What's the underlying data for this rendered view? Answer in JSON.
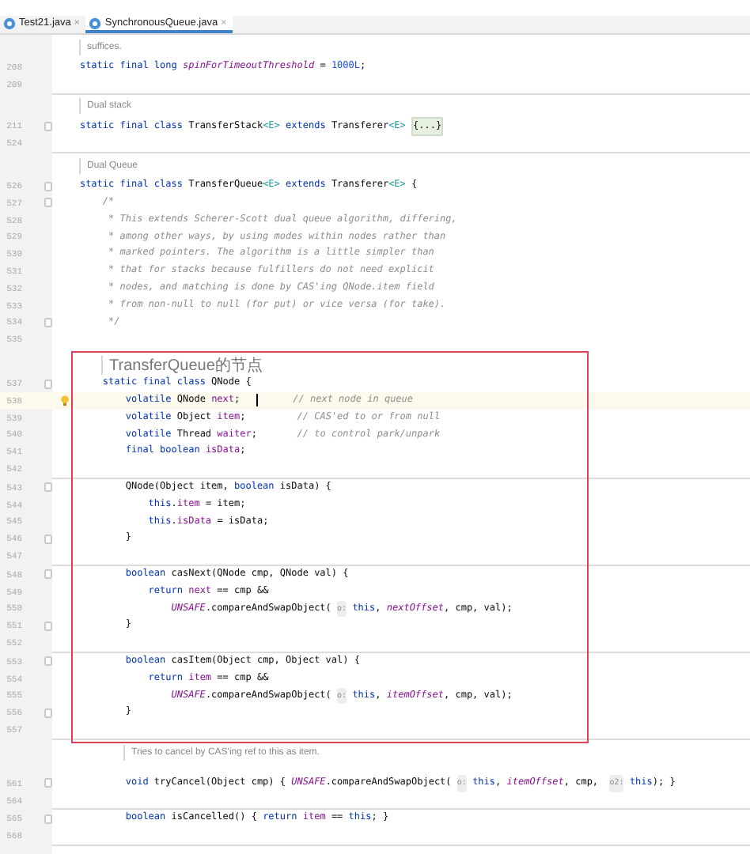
{
  "tabs": [
    {
      "label": "Test21.java",
      "close": "×",
      "selected": false
    },
    {
      "label": "SynchronousQueue.java",
      "close": "×",
      "selected": true
    }
  ],
  "rows": [
    {
      "kind": "doc_class",
      "text": "suffices."
    },
    {
      "kind": "code",
      "number": "208",
      "fold": false,
      "current": false,
      "tokens": [
        {
          "kind": "keyword",
          "t": "    static final long "
        },
        {
          "kind": "static",
          "t": "spinForTimeoutThreshold"
        },
        {
          "kind": "plain",
          "t": " = "
        },
        {
          "kind": "number",
          "t": "1000L"
        },
        {
          "kind": "plain",
          "t": ";"
        }
      ]
    },
    {
      "kind": "code",
      "number": "209",
      "fold": false,
      "current": false,
      "tokens": []
    },
    {
      "kind": "separator"
    },
    {
      "kind": "doc_class",
      "text": "Dual stack"
    },
    {
      "kind": "code",
      "number": "211",
      "fold": true,
      "current": false,
      "tokens": [
        {
          "kind": "keyword",
          "t": "    static final class "
        },
        {
          "kind": "plain",
          "t": "TransferStack"
        },
        {
          "kind": "generic",
          "t": "<E>"
        },
        {
          "kind": "keyword",
          "t": " extends "
        },
        {
          "kind": "plain",
          "t": "Transferer"
        },
        {
          "kind": "generic",
          "t": "<E> "
        },
        {
          "kind": "fold",
          "t": "{...}"
        }
      ]
    },
    {
      "kind": "code",
      "number": "524",
      "fold": false,
      "current": false,
      "tokens": []
    },
    {
      "kind": "separator"
    },
    {
      "kind": "doc_class",
      "text": "Dual Queue"
    },
    {
      "kind": "code",
      "number": "526",
      "fold": true,
      "current": false,
      "tokens": [
        {
          "kind": "keyword",
          "t": "    static final class "
        },
        {
          "kind": "plain",
          "t": "TransferQueue"
        },
        {
          "kind": "generic",
          "t": "<E>"
        },
        {
          "kind": "keyword",
          "t": " extends "
        },
        {
          "kind": "plain",
          "t": "Transferer"
        },
        {
          "kind": "generic",
          "t": "<E>"
        },
        {
          "kind": "plain",
          "t": " {"
        }
      ]
    },
    {
      "kind": "code",
      "number": "527",
      "fold": true,
      "current": false,
      "tokens": [
        {
          "kind": "comment",
          "t": "        /*"
        }
      ]
    },
    {
      "kind": "code",
      "number": "528",
      "fold": false,
      "current": false,
      "tokens": [
        {
          "kind": "comment",
          "t": "         * This extends Scherer-Scott dual queue algorithm, differing,"
        }
      ]
    },
    {
      "kind": "code",
      "number": "529",
      "fold": false,
      "current": false,
      "tokens": [
        {
          "kind": "comment",
          "t": "         * among other ways, by using modes within nodes rather than"
        }
      ]
    },
    {
      "kind": "code",
      "number": "530",
      "fold": false,
      "current": false,
      "tokens": [
        {
          "kind": "comment",
          "t": "         * marked pointers. The algorithm is a little simpler than"
        }
      ]
    },
    {
      "kind": "code",
      "number": "531",
      "fold": false,
      "current": false,
      "tokens": [
        {
          "kind": "comment",
          "t": "         * that for stacks because fulfillers do not need explicit"
        }
      ]
    },
    {
      "kind": "code",
      "number": "532",
      "fold": false,
      "current": false,
      "tokens": [
        {
          "kind": "comment",
          "t": "         * nodes, and matching is done by CAS'ing QNode.item field"
        }
      ]
    },
    {
      "kind": "code",
      "number": "533",
      "fold": false,
      "current": false,
      "tokens": [
        {
          "kind": "comment",
          "t": "         * from non-null to null (for put) or vice versa (for take)."
        }
      ]
    },
    {
      "kind": "code",
      "number": "534",
      "fold": true,
      "current": false,
      "tokens": [
        {
          "kind": "comment",
          "t": "         */"
        }
      ]
    },
    {
      "kind": "code",
      "number": "535",
      "fold": false,
      "current": false,
      "tokens": []
    },
    {
      "kind": "doc_member",
      "text": "TransferQueue的节点"
    },
    {
      "kind": "code",
      "number": "537",
      "fold": true,
      "current": false,
      "tokens": [
        {
          "kind": "keyword",
          "t": "        static final class "
        },
        {
          "kind": "plain",
          "t": "QNode {"
        }
      ]
    },
    {
      "kind": "code",
      "number": "538",
      "fold": false,
      "current": true,
      "tokens": [
        {
          "kind": "keyword",
          "t": "            volatile "
        },
        {
          "kind": "plain",
          "t": "QNode "
        },
        {
          "kind": "field",
          "t": "next"
        },
        {
          "kind": "plain",
          "t": ";   "
        },
        {
          "kind": "caret"
        },
        {
          "kind": "comment",
          "t": "      // next node in queue"
        }
      ]
    },
    {
      "kind": "code",
      "number": "539",
      "fold": false,
      "current": false,
      "tokens": [
        {
          "kind": "keyword",
          "t": "            volatile "
        },
        {
          "kind": "plain",
          "t": "Object "
        },
        {
          "kind": "field",
          "t": "item"
        },
        {
          "kind": "plain",
          "t": ";"
        },
        {
          "kind": "comment",
          "t": "         // CAS'ed to or from null"
        }
      ]
    },
    {
      "kind": "code",
      "number": "540",
      "fold": false,
      "current": false,
      "tokens": [
        {
          "kind": "keyword",
          "t": "            volatile "
        },
        {
          "kind": "plain",
          "t": "Thread "
        },
        {
          "kind": "field",
          "t": "waiter"
        },
        {
          "kind": "plain",
          "t": ";"
        },
        {
          "kind": "comment",
          "t": "       // to control park/unpark"
        }
      ]
    },
    {
      "kind": "code",
      "number": "541",
      "fold": false,
      "current": false,
      "tokens": [
        {
          "kind": "keyword",
          "t": "            final boolean "
        },
        {
          "kind": "field",
          "t": "isData"
        },
        {
          "kind": "plain",
          "t": ";"
        }
      ]
    },
    {
      "kind": "code",
      "number": "542",
      "fold": false,
      "current": false,
      "tokens": []
    },
    {
      "kind": "separator"
    },
    {
      "kind": "code",
      "number": "543",
      "fold": true,
      "current": false,
      "tokens": [
        {
          "kind": "plain",
          "t": "            QNode(Object item, "
        },
        {
          "kind": "keyword",
          "t": "boolean "
        },
        {
          "kind": "plain",
          "t": "isData) {"
        }
      ]
    },
    {
      "kind": "code",
      "number": "544",
      "fold": false,
      "current": false,
      "tokens": [
        {
          "kind": "keyword",
          "t": "                this"
        },
        {
          "kind": "plain",
          "t": "."
        },
        {
          "kind": "field",
          "t": "item"
        },
        {
          "kind": "plain",
          "t": " = item;"
        }
      ]
    },
    {
      "kind": "code",
      "number": "545",
      "fold": false,
      "current": false,
      "tokens": [
        {
          "kind": "keyword",
          "t": "                this"
        },
        {
          "kind": "plain",
          "t": "."
        },
        {
          "kind": "field",
          "t": "isData"
        },
        {
          "kind": "plain",
          "t": " = isData;"
        }
      ]
    },
    {
      "kind": "code",
      "number": "546",
      "fold": true,
      "current": false,
      "tokens": [
        {
          "kind": "plain",
          "t": "            }"
        }
      ]
    },
    {
      "kind": "code",
      "number": "547",
      "fold": false,
      "current": false,
      "tokens": []
    },
    {
      "kind": "separator"
    },
    {
      "kind": "code",
      "number": "548",
      "fold": true,
      "current": false,
      "tokens": [
        {
          "kind": "keyword",
          "t": "            boolean "
        },
        {
          "kind": "plain",
          "t": "casNext(QNode cmp, QNode val) {"
        }
      ]
    },
    {
      "kind": "code",
      "number": "549",
      "fold": false,
      "current": false,
      "tokens": [
        {
          "kind": "keyword",
          "t": "                return "
        },
        {
          "kind": "field",
          "t": "next"
        },
        {
          "kind": "plain",
          "t": " == cmp &&"
        }
      ]
    },
    {
      "kind": "code",
      "number": "550",
      "fold": false,
      "current": false,
      "tokens": [
        {
          "kind": "static",
          "t": "                    UNSAFE"
        },
        {
          "kind": "plain",
          "t": ".compareAndSwapObject( "
        },
        {
          "kind": "hint",
          "t": "o:"
        },
        {
          "kind": "keyword",
          "t": " this"
        },
        {
          "kind": "plain",
          "t": ", "
        },
        {
          "kind": "static",
          "t": "nextOffset"
        },
        {
          "kind": "plain",
          "t": ", cmp, val);"
        }
      ]
    },
    {
      "kind": "code",
      "number": "551",
      "fold": true,
      "current": false,
      "tokens": [
        {
          "kind": "plain",
          "t": "            }"
        }
      ]
    },
    {
      "kind": "code",
      "number": "552",
      "fold": false,
      "current": false,
      "tokens": []
    },
    {
      "kind": "separator"
    },
    {
      "kind": "code",
      "number": "553",
      "fold": true,
      "current": false,
      "tokens": [
        {
          "kind": "keyword",
          "t": "            boolean "
        },
        {
          "kind": "plain",
          "t": "casItem(Object cmp, Object val) {"
        }
      ]
    },
    {
      "kind": "code",
      "number": "554",
      "fold": false,
      "current": false,
      "tokens": [
        {
          "kind": "keyword",
          "t": "                return "
        },
        {
          "kind": "field",
          "t": "item"
        },
        {
          "kind": "plain",
          "t": " == cmp &&"
        }
      ]
    },
    {
      "kind": "code",
      "number": "555",
      "fold": false,
      "current": false,
      "tokens": [
        {
          "kind": "static",
          "t": "                    UNSAFE"
        },
        {
          "kind": "plain",
          "t": ".compareAndSwapObject( "
        },
        {
          "kind": "hint",
          "t": "o:"
        },
        {
          "kind": "keyword",
          "t": " this"
        },
        {
          "kind": "plain",
          "t": ", "
        },
        {
          "kind": "static",
          "t": "itemOffset"
        },
        {
          "kind": "plain",
          "t": ", cmp, val);"
        }
      ]
    },
    {
      "kind": "code",
      "number": "556",
      "fold": true,
      "current": false,
      "tokens": [
        {
          "kind": "plain",
          "t": "            }"
        }
      ]
    },
    {
      "kind": "code",
      "number": "557",
      "fold": false,
      "current": false,
      "tokens": []
    },
    {
      "kind": "separator"
    },
    {
      "kind": "doc_inner",
      "text": "Tries to cancel by CAS'ing ref to this as item."
    },
    {
      "kind": "code",
      "number": "561",
      "fold": true,
      "current": false,
      "tokens": [
        {
          "kind": "keyword",
          "t": "            void "
        },
        {
          "kind": "plain",
          "t": "tryCancel(Object cmp) { "
        },
        {
          "kind": "static",
          "t": "UNSAFE"
        },
        {
          "kind": "plain",
          "t": ".compareAndSwapObject( "
        },
        {
          "kind": "hint",
          "t": "o:"
        },
        {
          "kind": "keyword",
          "t": " this"
        },
        {
          "kind": "plain",
          "t": ", "
        },
        {
          "kind": "static",
          "t": "itemOffset"
        },
        {
          "kind": "plain",
          "t": ", cmp,  "
        },
        {
          "kind": "hint",
          "t": "o2:"
        },
        {
          "kind": "keyword",
          "t": " this"
        },
        {
          "kind": "plain",
          "t": "); }"
        }
      ]
    },
    {
      "kind": "code",
      "number": "564",
      "fold": false,
      "current": false,
      "tokens": []
    },
    {
      "kind": "separator"
    },
    {
      "kind": "code",
      "number": "565",
      "fold": true,
      "current": false,
      "tokens": [
        {
          "kind": "keyword",
          "t": "            boolean "
        },
        {
          "kind": "plain",
          "t": "isCancelled() { "
        },
        {
          "kind": "keyword",
          "t": "return "
        },
        {
          "kind": "field",
          "t": "item"
        },
        {
          "kind": "plain",
          "t": " == "
        },
        {
          "kind": "keyword",
          "t": "this"
        },
        {
          "kind": "plain",
          "t": "; }"
        }
      ]
    },
    {
      "kind": "code",
      "number": "568",
      "fold": false,
      "current": false,
      "tokens": []
    },
    {
      "kind": "separator"
    }
  ]
}
